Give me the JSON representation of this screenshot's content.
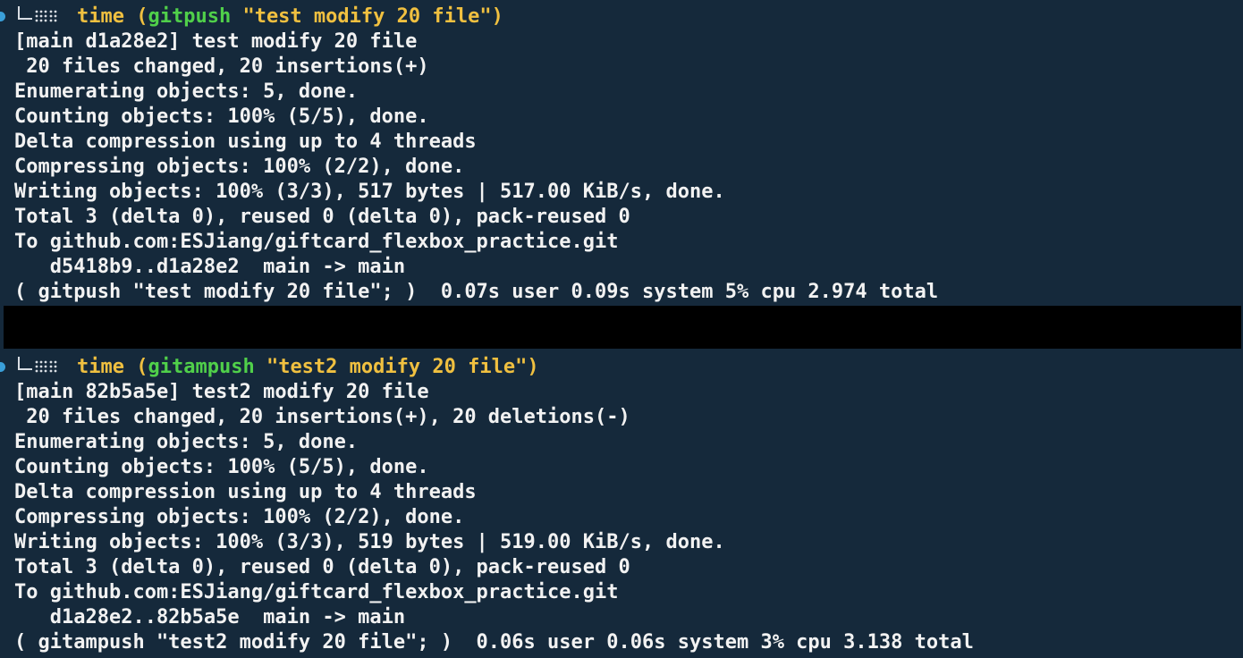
{
  "colors": {
    "background": "#15293b",
    "text": "#f2f2f2",
    "keyword": "#f0c040",
    "function": "#50d04a",
    "separator": "#000000",
    "dot": "#3a9fd9"
  },
  "runs": [
    {
      "prompt": {
        "icon": "tree-corner-icon",
        "cmd_time": "time",
        "open_paren": " (",
        "func": "gitpush",
        "args": " \"test modify 20 file\")"
      },
      "output": [
        "[main d1a28e2] test modify 20 file",
        " 20 files changed, 20 insertions(+)",
        "Enumerating objects: 5, done.",
        "Counting objects: 100% (5/5), done.",
        "Delta compression using up to 4 threads",
        "Compressing objects: 100% (2/2), done.",
        "Writing objects: 100% (3/3), 517 bytes | 517.00 KiB/s, done.",
        "Total 3 (delta 0), reused 0 (delta 0), pack-reused 0",
        "To github.com:ESJiang/giftcard_flexbox_practice.git",
        "   d5418b9..d1a28e2  main -> main",
        "( gitpush \"test modify 20 file\"; )  0.07s user 0.09s system 5% cpu 2.974 total"
      ]
    },
    {
      "prompt": {
        "icon": "tree-corner-icon",
        "cmd_time": "time",
        "open_paren": " (",
        "func": "gitampush",
        "args": " \"test2 modify 20 file\")"
      },
      "output": [
        "[main 82b5a5e] test2 modify 20 file",
        " 20 files changed, 20 insertions(+), 20 deletions(-)",
        "Enumerating objects: 5, done.",
        "Counting objects: 100% (5/5), done.",
        "Delta compression using up to 4 threads",
        "Compressing objects: 100% (2/2), done.",
        "Writing objects: 100% (3/3), 519 bytes | 519.00 KiB/s, done.",
        "Total 3 (delta 0), reused 0 (delta 0), pack-reused 0",
        "To github.com:ESJiang/giftcard_flexbox_practice.git",
        "   d1a28e2..82b5a5e  main -> main",
        "( gitampush \"test2 modify 20 file\"; )  0.06s user 0.06s system 3% cpu 3.138 total"
      ]
    }
  ]
}
